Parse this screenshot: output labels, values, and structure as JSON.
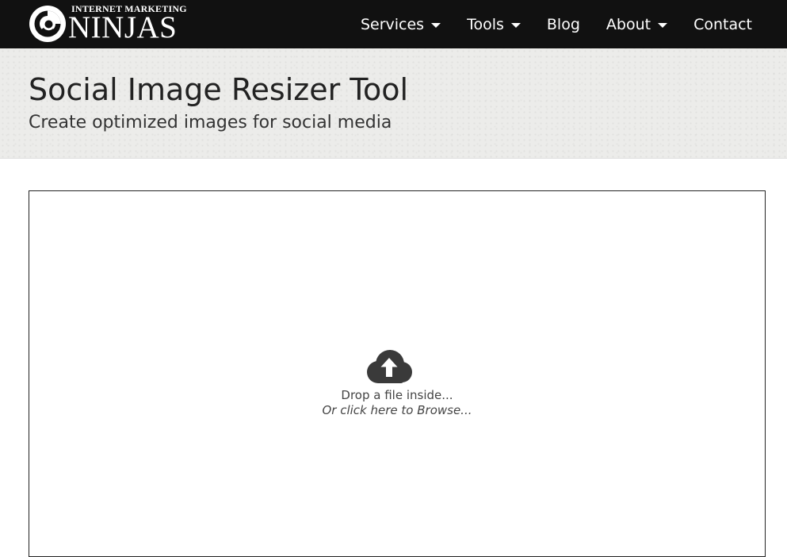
{
  "brand": {
    "tagline": "INTERNET MARKETING",
    "name": "NINJAS",
    "logo_icon": "swirl-logo-icon"
  },
  "nav": {
    "items": [
      {
        "label": "Services",
        "dropdown": true
      },
      {
        "label": "Tools",
        "dropdown": true
      },
      {
        "label": "Blog",
        "dropdown": false
      },
      {
        "label": "About",
        "dropdown": true
      },
      {
        "label": "Contact",
        "dropdown": false
      }
    ]
  },
  "hero": {
    "title": "Social Image Resizer Tool",
    "subtitle": "Create optimized images for social media"
  },
  "uploader": {
    "icon": "cloud-upload-icon",
    "drop_text": "Drop a file inside...",
    "browse_text": "Or click here to Browse..."
  },
  "colors": {
    "navbar_bg": "#111111",
    "hero_bg": "#ececea",
    "text_dark": "#222222",
    "icon_dark": "#3a3a3a"
  }
}
